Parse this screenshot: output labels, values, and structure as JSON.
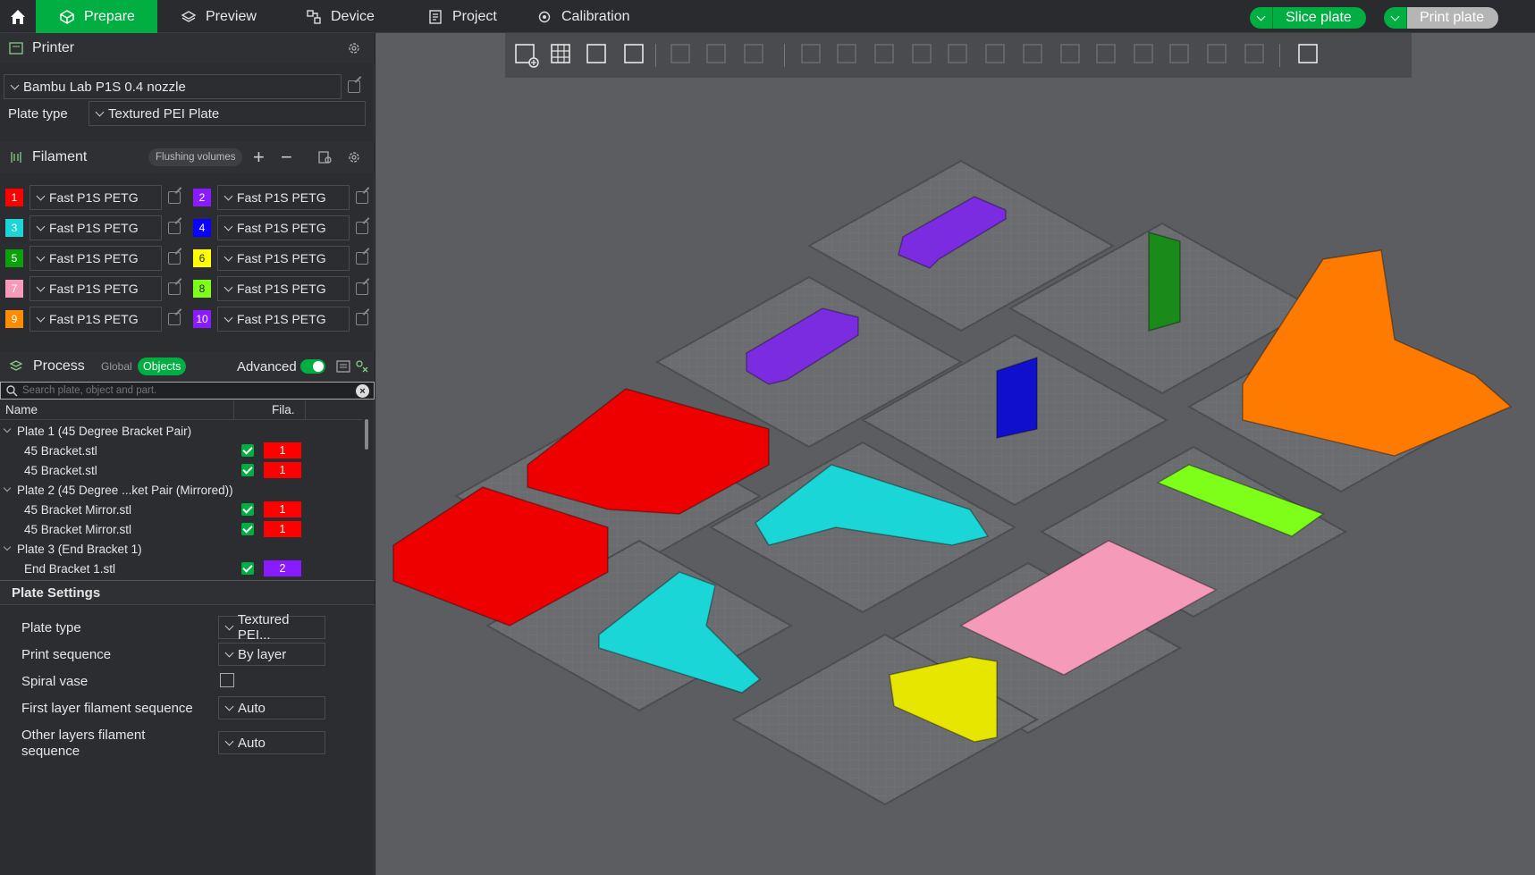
{
  "top": {
    "tabs": [
      "Prepare",
      "Preview",
      "Device",
      "Project",
      "Calibration"
    ],
    "slice": "Slice plate",
    "print": "Print plate"
  },
  "printer": {
    "header": "Printer",
    "name": "Bambu Lab P1S 0.4 nozzle",
    "plate_type_label": "Plate type",
    "plate_type_value": "Textured PEI Plate"
  },
  "filament": {
    "header": "Filament",
    "flushing": "Flushing volumes",
    "items": [
      {
        "num": "1",
        "color": "#ff0000",
        "name": "Fast P1S PETG"
      },
      {
        "num": "2",
        "color": "#8a1aff",
        "name": "Fast P1S PETG"
      },
      {
        "num": "3",
        "color": "#1ad6d6",
        "name": "Fast P1S PETG"
      },
      {
        "num": "4",
        "color": "#0a00ff",
        "name": "Fast P1S PETG"
      },
      {
        "num": "5",
        "color": "#0aa00a",
        "name": "Fast P1S PETG"
      },
      {
        "num": "6",
        "color": "#ffff00",
        "name": "Fast P1S PETG"
      },
      {
        "num": "7",
        "color": "#f59ab8",
        "name": "Fast P1S PETG"
      },
      {
        "num": "8",
        "color": "#7dff1a",
        "name": "Fast P1S PETG"
      },
      {
        "num": "9",
        "color": "#ff8c00",
        "name": "Fast P1S PETG"
      },
      {
        "num": "10",
        "color": "#8a1aff",
        "name": "Fast P1S PETG"
      }
    ]
  },
  "process": {
    "header": "Process",
    "global": "Global",
    "objects": "Objects",
    "advanced": "Advanced",
    "search_placeholder": "Search plate, object and part.",
    "col_name": "Name",
    "col_fila": "Fila.",
    "rows": [
      {
        "text": "Plate 1 (45 Degree Bracket Pair)",
        "type": "plate"
      },
      {
        "text": "45 Bracket.stl",
        "type": "obj",
        "fil": "1",
        "color": "#ff0000"
      },
      {
        "text": "45 Bracket.stl",
        "type": "obj",
        "fil": "1",
        "color": "#ff0000"
      },
      {
        "text": "Plate 2 (45 Degree ...ket Pair (Mirrored))",
        "type": "plate"
      },
      {
        "text": "45 Bracket Mirror.stl",
        "type": "obj",
        "fil": "1",
        "color": "#ff0000"
      },
      {
        "text": "45 Bracket Mirror.stl",
        "type": "obj",
        "fil": "1",
        "color": "#ff0000"
      },
      {
        "text": "Plate 3 (End Bracket 1)",
        "type": "plate"
      },
      {
        "text": "End Bracket 1.stl",
        "type": "obj",
        "fil": "2",
        "color": "#8a1aff"
      }
    ]
  },
  "plate_settings": {
    "header": "Plate Settings",
    "rows": [
      {
        "label": "Plate type",
        "value": "Textured PEI..."
      },
      {
        "label": "Print sequence",
        "value": "By layer"
      },
      {
        "label": "Spiral vase",
        "value": ""
      },
      {
        "label": "First layer filament sequence",
        "value": "Auto"
      },
      {
        "label": "Other layers filament",
        "label2": "sequence",
        "value": "Auto"
      }
    ]
  }
}
